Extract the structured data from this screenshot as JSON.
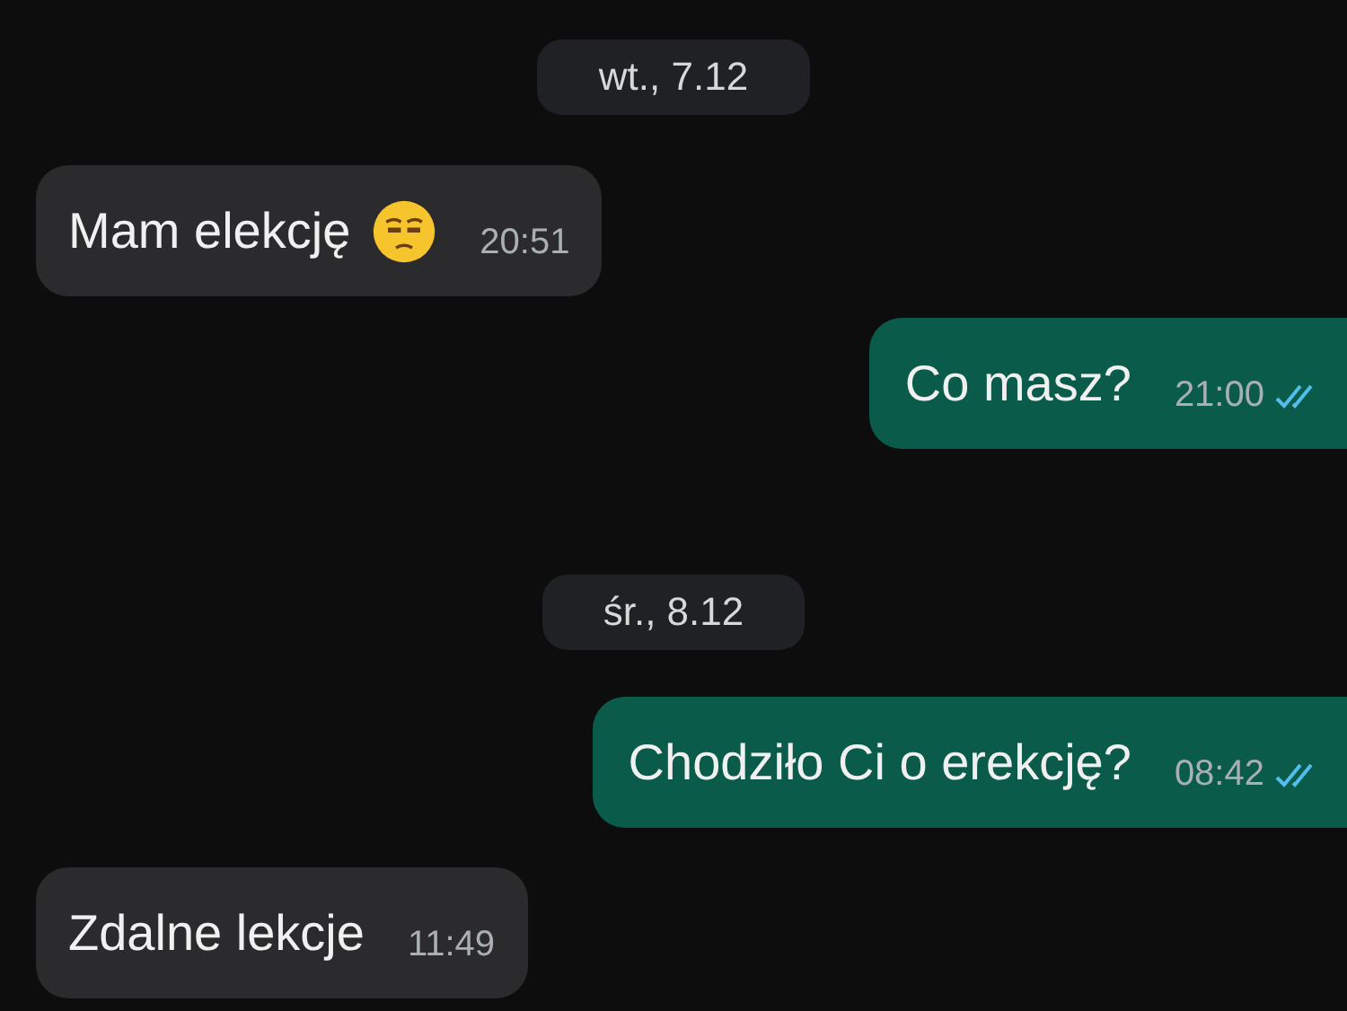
{
  "chat": [
    {
      "kind": "date",
      "text": "wt., 7.12"
    },
    {
      "kind": "message",
      "outgoing": false,
      "text": "Mam elekcję",
      "has_emoji": true,
      "time": "20:51"
    },
    {
      "kind": "message",
      "outgoing": true,
      "text": "Co masz?",
      "has_emoji": false,
      "time": "21:00",
      "read": true
    },
    {
      "kind": "date",
      "text": "śr., 8.12"
    },
    {
      "kind": "message",
      "outgoing": true,
      "text": "Chodziło Ci o erekcję?",
      "has_emoji": false,
      "time": "08:42",
      "read": true
    },
    {
      "kind": "message",
      "outgoing": false,
      "text": "Zdalne lekcje",
      "has_emoji": false,
      "time": "11:49"
    }
  ]
}
